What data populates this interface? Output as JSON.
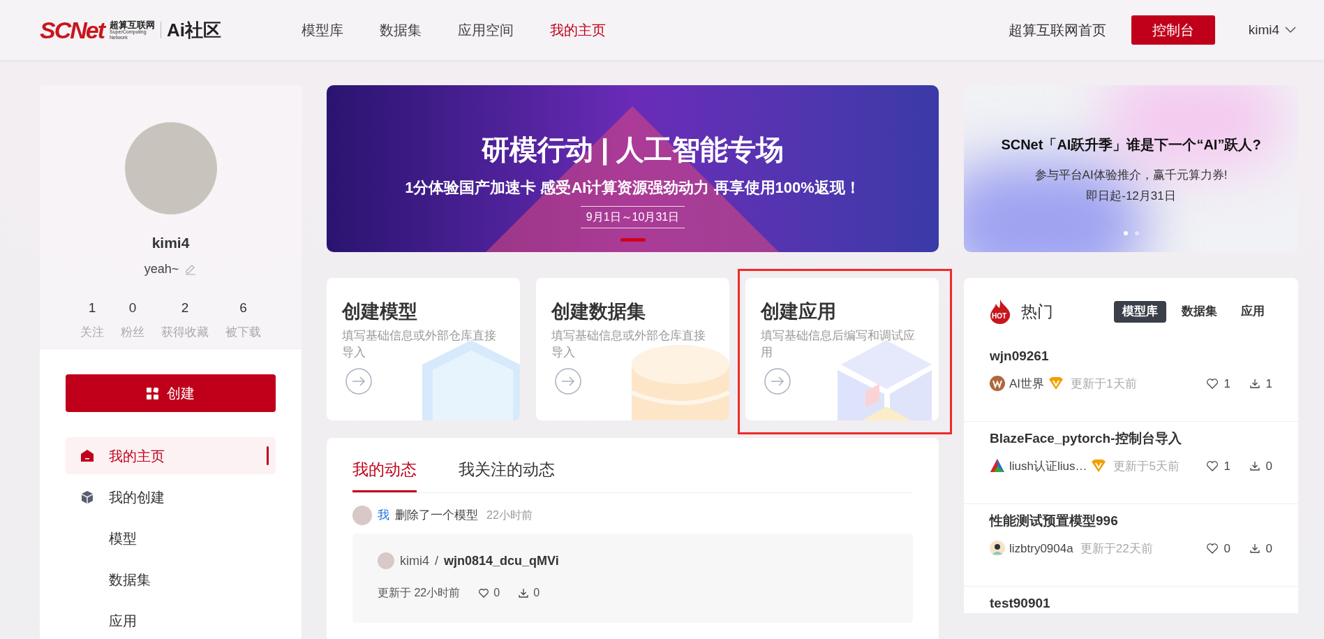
{
  "header": {
    "logo": {
      "brand": "SCNet",
      "cn": "超算互联网",
      "en": "SuperComputing Network",
      "community": "Ai社区"
    },
    "nav": [
      {
        "label": "模型库",
        "selected": false
      },
      {
        "label": "数据集",
        "selected": false
      },
      {
        "label": "应用空间",
        "selected": false
      },
      {
        "label": "我的主页",
        "selected": true
      }
    ],
    "home_link": "超算互联网首页",
    "console_button": "控制台",
    "user": "kimi4"
  },
  "profile": {
    "name": "kimi4",
    "bio": "yeah~",
    "stats": [
      {
        "value": "1",
        "label": "关注"
      },
      {
        "value": "0",
        "label": "粉丝"
      },
      {
        "value": "2",
        "label": "获得收藏"
      },
      {
        "value": "6",
        "label": "被下载"
      }
    ],
    "create_button": "创建",
    "menu": [
      {
        "label": "我的主页",
        "kind": "home",
        "selected": true
      },
      {
        "label": "我的创建",
        "kind": "cube",
        "selected": false
      },
      {
        "label": "模型",
        "kind": "sub",
        "selected": false
      },
      {
        "label": "数据集",
        "kind": "sub",
        "selected": false
      },
      {
        "label": "应用",
        "kind": "sub",
        "selected": false
      }
    ]
  },
  "banner": {
    "title": "研模行动 | 人工智能专场",
    "subtitle": "1分体验国产加速卡 感受AI计算资源强劲动力 再享使用100%返现！",
    "date": "9月1日～10月31日"
  },
  "create_cards": [
    {
      "kind": "model",
      "title": "创建模型",
      "desc": "填写基础信息或外部仓库直接导入",
      "highlighted": false
    },
    {
      "kind": "dataset",
      "title": "创建数据集",
      "desc": "填写基础信息或外部仓库直接导入",
      "highlighted": false
    },
    {
      "kind": "app",
      "title": "创建应用",
      "desc": "填写基础信息后编写和调试应用",
      "highlighted": true
    }
  ],
  "feed": {
    "tabs": [
      {
        "label": "我的动态",
        "selected": true
      },
      {
        "label": "我关注的动态",
        "selected": false
      }
    ],
    "activities": [
      {
        "actor": "我",
        "action": "删除了一个模型",
        "time": "22小时前",
        "owner": "kimi4",
        "separator": "/",
        "model": "wjn0814_dcu_qMVi",
        "updated": "更新于 22小时前",
        "likes": "0",
        "downloads": "0"
      }
    ]
  },
  "promo": {
    "title": "SCNet「AI跃升季」谁是下一个“AI”跃人?",
    "line1": "参与平台AI体验推介，赢千元算力券!",
    "line2": "即日起-12月31日",
    "dots": [
      {
        "selected": true
      },
      {
        "selected": false
      }
    ]
  },
  "hot": {
    "badge": "HOT",
    "title": "热门",
    "tabs": [
      {
        "label": "模型库",
        "selected": true
      },
      {
        "label": "数据集",
        "selected": false
      },
      {
        "label": "应用",
        "selected": false
      }
    ],
    "items": [
      {
        "name": "wjn09261",
        "author": "AI世界",
        "kind": "letter",
        "verified": true,
        "updated": "更新于1天前",
        "likes": "1",
        "downloads": "1"
      },
      {
        "name": "BlazeFace_pytorch-控制台导入",
        "author": "liush认证lius…",
        "kind": "triangle",
        "verified": true,
        "updated": "更新于5天前",
        "likes": "1",
        "downloads": "0"
      },
      {
        "name": "性能测试预置模型996",
        "author": "lizbtry0904a",
        "kind": "person",
        "verified": false,
        "updated": "更新于22天前",
        "likes": "0",
        "downloads": "0"
      },
      {
        "name": "test90901"
      }
    ]
  }
}
